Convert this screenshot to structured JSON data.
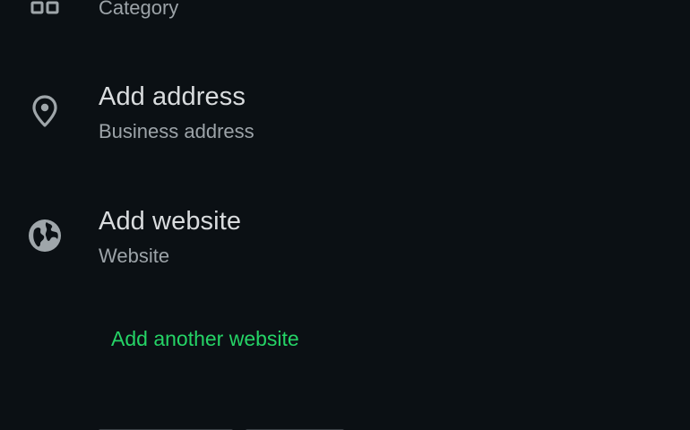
{
  "rows": {
    "category": {
      "title": "",
      "subtitle": "Category",
      "icon": "category-icon"
    },
    "address": {
      "title": "Add address",
      "subtitle": "Business address",
      "icon": "location-pin-icon"
    },
    "website": {
      "title": "Add website",
      "subtitle": "Website",
      "icon": "globe-icon"
    }
  },
  "add_another_website": "Add another website",
  "colors": {
    "background": "#0b1014",
    "accent": "#25d366",
    "primary_text": "#d9dcde",
    "secondary_text": "#9ca3a8",
    "icon": "#9fa6aa"
  }
}
